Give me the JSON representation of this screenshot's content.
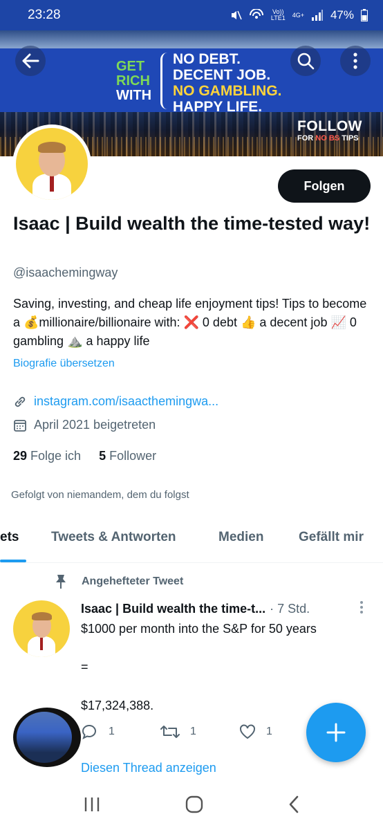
{
  "status": {
    "time": "23:28",
    "volte_top": "Vo))",
    "volte_bottom": "LTE1",
    "network": "4G+",
    "battery": "47%"
  },
  "banner": {
    "get": "GET",
    "rich": "RICH",
    "with": "WITH",
    "line1": "NO DEBT.",
    "line2": "DECENT JOB.",
    "line3": "NO GAMBLING.",
    "line4": "HAPPY LIFE.",
    "follow": "FOLLOW",
    "for_no_bs_prefix": "FOR ",
    "for_no_bs_highlight": "NO BS",
    "for_no_bs_suffix": " TIPS",
    "colors": {
      "green": "#7ed957",
      "gold": "#ffd43b",
      "band": "#1f48b6"
    }
  },
  "profile": {
    "follow_button": "Folgen",
    "display_name": "Isaac | Build wealth the time-tested way!",
    "handle": "@isaachemingway",
    "bio": "Saving, investing, and cheap life enjoyment tips! Tips to become a 💰millionaire/billionaire with: ❌ 0 debt 👍 a decent job 📈 0 gambling ⛰️ a happy life",
    "translate_bio": "Biografie übersetzen",
    "link": "instagram.com/isaacthemingwa...",
    "joined": "April 2021 beigetreten",
    "following_count": "29",
    "following_label": "Folge ich",
    "followers_count": "5",
    "followers_label": "Follower",
    "followed_by": "Gefolgt von niemandem, dem du folgst"
  },
  "tabs": [
    {
      "label": "ets",
      "active": true
    },
    {
      "label": "Tweets & Antworten",
      "active": false
    },
    {
      "label": "Medien",
      "active": false
    },
    {
      "label": "Gefällt mir",
      "active": false
    }
  ],
  "tweet": {
    "pinned_label": "Angehefteter Tweet",
    "name": "Isaac | Build wealth the time-t...",
    "time": "· 7 Std.",
    "line1": "$1000 per month into the S&P for 50 years",
    "line2": "=",
    "line3": "$17,324,388.",
    "replies": "1",
    "retweets": "1",
    "likes": "1",
    "show_thread": "Diesen Thread anzeigen"
  },
  "icons": {
    "accent": "#1d9bf0"
  }
}
